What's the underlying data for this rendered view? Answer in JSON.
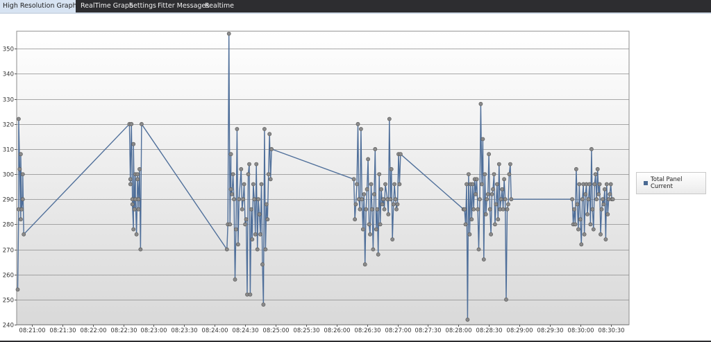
{
  "tabs": [
    {
      "label": "High Resolution Graph",
      "active": true,
      "close_icon": "×"
    },
    {
      "label": "RealTime Graph",
      "active": false
    },
    {
      "label": "Settings",
      "active": false
    },
    {
      "label": "Fitter Messages",
      "active": false
    },
    {
      "label": "Realtime",
      "active": false
    }
  ],
  "colors": {
    "line": "#4f6f9a",
    "marker": "#8a8a8a",
    "grid": "#8c8c8c",
    "plot_top": "#ffffff",
    "plot_bottom": "#d9d9d9"
  },
  "chart_data": {
    "type": "line",
    "title": "",
    "xlabel": "",
    "ylabel": "",
    "ylim": [
      240,
      357
    ],
    "xlim": [
      "08:20:45",
      "08:30:48"
    ],
    "yticks": [
      240,
      250,
      260,
      270,
      280,
      290,
      300,
      310,
      320,
      330,
      340,
      350
    ],
    "xticks": [
      "08:21:00",
      "08:21:30",
      "08:22:00",
      "08:22:30",
      "08:23:00",
      "08:23:30",
      "08:24:00",
      "08:24:30",
      "08:25:00",
      "08:25:30",
      "08:26:00",
      "08:26:30",
      "08:27:00",
      "08:27:30",
      "08:28:00",
      "08:28:30",
      "08:29:00",
      "08:29:30",
      "08:30:00",
      "08:30:30"
    ],
    "grid": true,
    "markers": true,
    "legend_position": "right",
    "series": [
      {
        "name": "Total Panel Current",
        "points": [
          [
            "08:20:46",
            254
          ],
          [
            "08:20:47",
            286
          ],
          [
            "08:20:47",
            322
          ],
          [
            "08:20:48",
            302
          ],
          [
            "08:20:49",
            282
          ],
          [
            "08:20:49",
            308
          ],
          [
            "08:20:50",
            286
          ],
          [
            "08:20:51",
            290
          ],
          [
            "08:20:51",
            300
          ],
          [
            "08:20:52",
            276
          ],
          [
            "08:22:36",
            320
          ],
          [
            "08:22:37",
            296
          ],
          [
            "08:22:37",
            298
          ],
          [
            "08:22:38",
            320
          ],
          [
            "08:22:39",
            290
          ],
          [
            "08:22:39",
            288
          ],
          [
            "08:22:40",
            278
          ],
          [
            "08:22:40",
            312
          ],
          [
            "08:22:41",
            286
          ],
          [
            "08:22:42",
            300
          ],
          [
            "08:22:42",
            290
          ],
          [
            "08:22:43",
            276
          ],
          [
            "08:22:44",
            298
          ],
          [
            "08:22:44",
            300
          ],
          [
            "08:22:45",
            290
          ],
          [
            "08:22:45",
            286
          ],
          [
            "08:22:46",
            302
          ],
          [
            "08:22:47",
            270
          ],
          [
            "08:22:48",
            320
          ],
          [
            "08:24:12",
            270
          ],
          [
            "08:24:13",
            280
          ],
          [
            "08:24:14",
            356
          ],
          [
            "08:24:15",
            280
          ],
          [
            "08:24:16",
            308
          ],
          [
            "08:24:16",
            294
          ],
          [
            "08:24:17",
            292
          ],
          [
            "08:24:18",
            300
          ],
          [
            "08:24:19",
            290
          ],
          [
            "08:24:20",
            258
          ],
          [
            "08:24:21",
            278
          ],
          [
            "08:24:22",
            318
          ],
          [
            "08:24:23",
            272
          ],
          [
            "08:24:24",
            290
          ],
          [
            "08:24:26",
            302
          ],
          [
            "08:24:27",
            286
          ],
          [
            "08:24:28",
            290
          ],
          [
            "08:24:29",
            296
          ],
          [
            "08:24:30",
            280
          ],
          [
            "08:24:31",
            282
          ],
          [
            "08:24:32",
            252
          ],
          [
            "08:24:33",
            300
          ],
          [
            "08:24:34",
            304
          ],
          [
            "08:24:35",
            252
          ],
          [
            "08:24:36",
            286
          ],
          [
            "08:24:37",
            274
          ],
          [
            "08:24:38",
            296
          ],
          [
            "08:24:39",
            290
          ],
          [
            "08:24:40",
            276
          ],
          [
            "08:24:41",
            304
          ],
          [
            "08:24:42",
            270
          ],
          [
            "08:24:43",
            290
          ],
          [
            "08:24:44",
            284
          ],
          [
            "08:24:45",
            276
          ],
          [
            "08:24:46",
            296
          ],
          [
            "08:24:47",
            264
          ],
          [
            "08:24:48",
            248
          ],
          [
            "08:24:49",
            318
          ],
          [
            "08:24:50",
            270
          ],
          [
            "08:24:51",
            288
          ],
          [
            "08:24:52",
            282
          ],
          [
            "08:24:53",
            300
          ],
          [
            "08:24:54",
            316
          ],
          [
            "08:24:55",
            298
          ],
          [
            "08:24:56",
            310
          ],
          [
            "08:26:17",
            298
          ],
          [
            "08:26:18",
            282
          ],
          [
            "08:26:19",
            288
          ],
          [
            "08:26:20",
            296
          ],
          [
            "08:26:21",
            320
          ],
          [
            "08:26:22",
            290
          ],
          [
            "08:26:23",
            286
          ],
          [
            "08:26:24",
            318
          ],
          [
            "08:26:25",
            290
          ],
          [
            "08:26:26",
            278
          ],
          [
            "08:26:27",
            292
          ],
          [
            "08:26:28",
            264
          ],
          [
            "08:26:29",
            286
          ],
          [
            "08:26:30",
            294
          ],
          [
            "08:26:31",
            306
          ],
          [
            "08:26:32",
            280
          ],
          [
            "08:26:33",
            276
          ],
          [
            "08:26:34",
            296
          ],
          [
            "08:26:35",
            286
          ],
          [
            "08:26:36",
            270
          ],
          [
            "08:26:37",
            292
          ],
          [
            "08:26:38",
            310
          ],
          [
            "08:26:39",
            278
          ],
          [
            "08:26:40",
            286
          ],
          [
            "08:26:41",
            268
          ],
          [
            "08:26:42",
            300
          ],
          [
            "08:26:43",
            280
          ],
          [
            "08:26:44",
            294
          ],
          [
            "08:26:45",
            288
          ],
          [
            "08:26:46",
            290
          ],
          [
            "08:26:47",
            286
          ],
          [
            "08:26:48",
            296
          ],
          [
            "08:26:50",
            290
          ],
          [
            "08:26:51",
            284
          ],
          [
            "08:26:52",
            322
          ],
          [
            "08:26:53",
            290
          ],
          [
            "08:26:54",
            302
          ],
          [
            "08:26:55",
            274
          ],
          [
            "08:26:56",
            288
          ],
          [
            "08:26:57",
            296
          ],
          [
            "08:26:58",
            290
          ],
          [
            "08:26:59",
            286
          ],
          [
            "08:27:00",
            288
          ],
          [
            "08:27:01",
            308
          ],
          [
            "08:27:02",
            296
          ],
          [
            "08:27:03",
            308
          ],
          [
            "08:28:05",
            286
          ],
          [
            "08:28:06",
            286
          ],
          [
            "08:28:07",
            280
          ],
          [
            "08:28:08",
            296
          ],
          [
            "08:28:09",
            242
          ],
          [
            "08:28:10",
            300
          ],
          [
            "08:28:11",
            276
          ],
          [
            "08:28:12",
            296
          ],
          [
            "08:28:13",
            282
          ],
          [
            "08:28:14",
            296
          ],
          [
            "08:28:15",
            286
          ],
          [
            "08:28:16",
            298
          ],
          [
            "08:28:17",
            292
          ],
          [
            "08:28:18",
            298
          ],
          [
            "08:28:19",
            286
          ],
          [
            "08:28:20",
            270
          ],
          [
            "08:28:21",
            290
          ],
          [
            "08:28:22",
            328
          ],
          [
            "08:28:23",
            296
          ],
          [
            "08:28:24",
            314
          ],
          [
            "08:28:25",
            266
          ],
          [
            "08:28:26",
            300
          ],
          [
            "08:28:27",
            284
          ],
          [
            "08:28:28",
            290
          ],
          [
            "08:28:29",
            292
          ],
          [
            "08:28:30",
            308
          ],
          [
            "08:28:31",
            286
          ],
          [
            "08:28:32",
            276
          ],
          [
            "08:28:33",
            292
          ],
          [
            "08:28:34",
            294
          ],
          [
            "08:28:35",
            300
          ],
          [
            "08:28:36",
            280
          ],
          [
            "08:28:37",
            288
          ],
          [
            "08:28:38",
            296
          ],
          [
            "08:28:39",
            282
          ],
          [
            "08:28:40",
            304
          ],
          [
            "08:28:41",
            286
          ],
          [
            "08:28:42",
            290
          ],
          [
            "08:28:43",
            294
          ],
          [
            "08:28:44",
            286
          ],
          [
            "08:28:45",
            298
          ],
          [
            "08:28:46",
            290
          ],
          [
            "08:28:47",
            250
          ],
          [
            "08:28:48",
            286
          ],
          [
            "08:28:49",
            288
          ],
          [
            "08:28:50",
            300
          ],
          [
            "08:28:51",
            304
          ],
          [
            "08:28:52",
            290
          ],
          [
            "08:29:52",
            290
          ],
          [
            "08:29:53",
            280
          ],
          [
            "08:29:54",
            286
          ],
          [
            "08:29:55",
            280
          ],
          [
            "08:29:56",
            302
          ],
          [
            "08:29:57",
            288
          ],
          [
            "08:29:58",
            278
          ],
          [
            "08:29:59",
            296
          ],
          [
            "08:30:00",
            282
          ],
          [
            "08:30:01",
            272
          ],
          [
            "08:30:02",
            290
          ],
          [
            "08:30:03",
            296
          ],
          [
            "08:30:04",
            276
          ],
          [
            "08:30:05",
            292
          ],
          [
            "08:30:06",
            296
          ],
          [
            "08:30:07",
            284
          ],
          [
            "08:30:08",
            290
          ],
          [
            "08:30:09",
            296
          ],
          [
            "08:30:10",
            280
          ],
          [
            "08:30:11",
            310
          ],
          [
            "08:30:12",
            286
          ],
          [
            "08:30:13",
            278
          ],
          [
            "08:30:14",
            296
          ],
          [
            "08:30:15",
            300
          ],
          [
            "08:30:16",
            290
          ],
          [
            "08:30:17",
            302
          ],
          [
            "08:30:18",
            292
          ],
          [
            "08:30:19",
            296
          ],
          [
            "08:30:20",
            276
          ],
          [
            "08:30:21",
            286
          ],
          [
            "08:30:22",
            290
          ],
          [
            "08:30:23",
            288
          ],
          [
            "08:30:24",
            294
          ],
          [
            "08:30:25",
            274
          ],
          [
            "08:30:26",
            296
          ],
          [
            "08:30:27",
            284
          ],
          [
            "08:30:28",
            290
          ],
          [
            "08:30:29",
            292
          ],
          [
            "08:30:30",
            296
          ],
          [
            "08:30:31",
            290
          ],
          [
            "08:30:32",
            290
          ]
        ]
      }
    ]
  }
}
